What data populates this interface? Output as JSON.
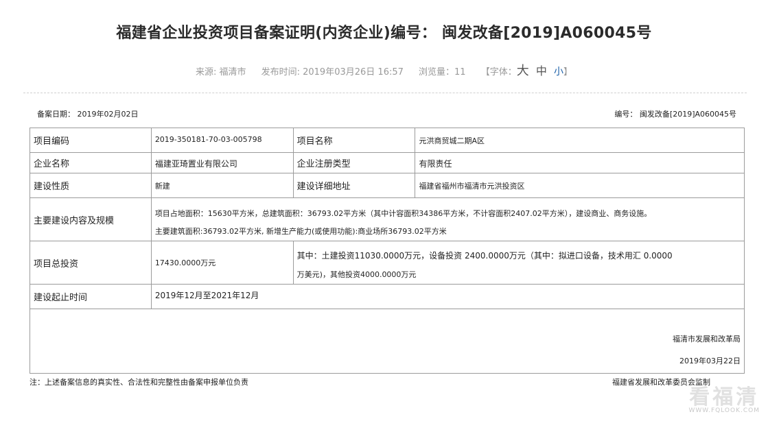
{
  "title": "福建省企业投资项目备案证明(内资企业)编号： 闽发改备[2019]A060045号",
  "meta": {
    "source": "来源: 福清市",
    "publish_time": "发布时间: 2019年03月26日 16:57",
    "views": "浏览量：11",
    "font_label_open": "【字体：",
    "font_big": "大",
    "font_mid": "中",
    "font_small": "小",
    "font_label_close": "】"
  },
  "record_date": "备案日期： 2019年02月02日",
  "record_no": "编号： 闽发改备[2019]A060045号",
  "table": {
    "project_code_label": "项目编码",
    "project_code": "2019-350181-70-03-005798",
    "project_name_label": "项目名称",
    "project_name": "元洪商贸城二期A区",
    "company_label": "企业名称",
    "company": "福建亚琦置业有限公司",
    "company_type_label": "企业注册类型",
    "company_type": "有限责任",
    "nature_label": "建设性质",
    "nature": "新建",
    "address_label": "建设详细地址",
    "address": "福建省福州市福清市元洪投资区",
    "content_label": "主要建设内容及规模",
    "content_line1": "项目占地面积：15630平方米，总建筑面积：36793.02平方米（其中计容面积34386平方米，不计容面积2407.02平方米），建设商业、商务设施。",
    "content_line2": "主要建筑面积:36793.02平方米, 新增生产能力(或使用功能):商业场所36793.02平方米",
    "investment_label": "项目总投资",
    "investment": "17430.0000万元",
    "investment_detail_line1": "其中：土建投资11030.0000万元，设备投资 2400.0000万元（其中：拟进口设备，技术用汇 0.0000",
    "investment_detail_line2": "万美元)，其他投资4000.0000万元",
    "period_label": "建设起止时间",
    "period": "2019年12月至2021年12月",
    "sign_org": "福清市发展和改革局",
    "sign_date": "2019年03月22日"
  },
  "note": "注：上述备案信息的真实性、合法性和完整性由备案申报单位负责",
  "made_by": "福建省发展和改革委员会监制",
  "watermark": {
    "cn": "看福清",
    "url": "WWW.FQLOOK.COM"
  }
}
